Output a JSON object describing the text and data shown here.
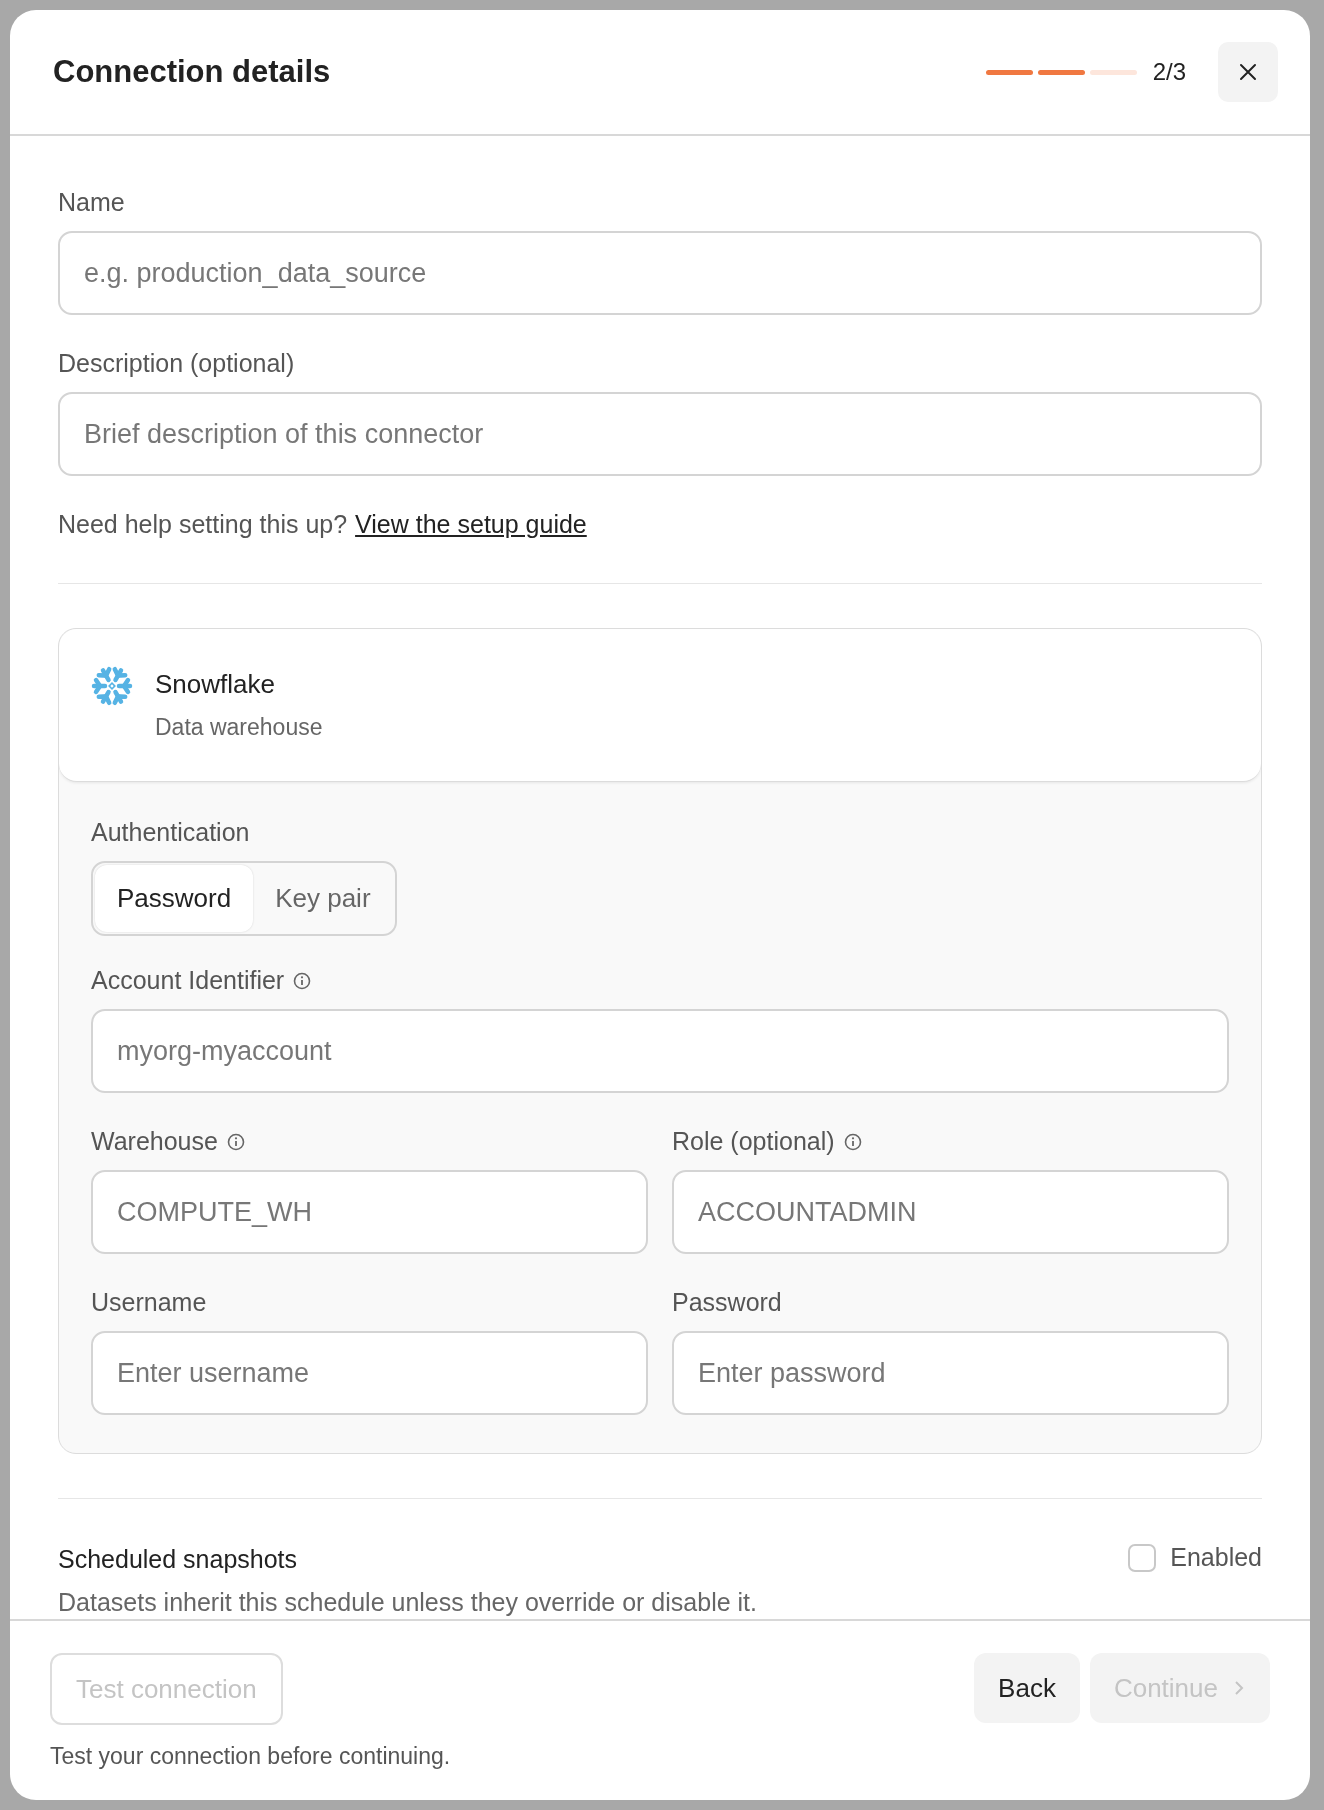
{
  "dialog": {
    "title": "Connection details",
    "progress": {
      "steps": [
        {
          "done": true
        },
        {
          "done": true
        },
        {
          "done": false
        }
      ],
      "text": "2/3"
    }
  },
  "fields": [
    {
      "label": "Name",
      "placeholder": "e.g. production_data_source"
    },
    {
      "label": "Description (optional)",
      "placeholder": "Brief description of this connector"
    }
  ],
  "help": {
    "text": "Need help setting this up?",
    "link": "View the setup guide"
  },
  "connector": {
    "name": "Snowflake",
    "type": "Data warehouse",
    "auth": {
      "label": "Authentication",
      "options": [
        {
          "label": "Password",
          "selected": true
        },
        {
          "label": "Key pair",
          "selected": false
        }
      ]
    },
    "rows": [
      [
        {
          "label": "Account Identifier",
          "info": true,
          "placeholder": "myorg-myaccount"
        }
      ],
      [
        {
          "label": "Warehouse",
          "info": true,
          "placeholder": "COMPUTE_WH"
        },
        {
          "label": "Role (optional)",
          "info": true,
          "placeholder": "ACCOUNTADMIN"
        }
      ],
      [
        {
          "label": "Username",
          "info": false,
          "placeholder": "Enter username"
        },
        {
          "label": "Password",
          "info": false,
          "placeholder": "Enter password"
        }
      ]
    ]
  },
  "schedule": {
    "title": "Scheduled snapshots",
    "description": "Datasets inherit this schedule unless they override or disable it.",
    "toggle": {
      "label": "Enabled",
      "checked": false
    }
  },
  "footer": {
    "test_button": {
      "label": "Test connection",
      "disabled": true
    },
    "hint": "Test your connection before continuing.",
    "buttons": [
      {
        "label": "Back",
        "kind": "secondary",
        "disabled": false
      },
      {
        "label": "Continue",
        "kind": "next",
        "disabled": true
      }
    ]
  }
}
